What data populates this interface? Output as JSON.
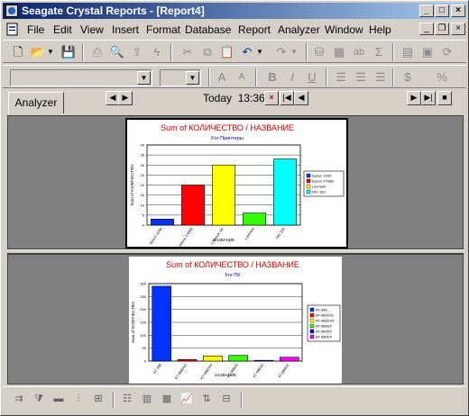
{
  "window": {
    "title": "Seagate Crystal Reports - [Report4]",
    "controls": {
      "minimize": "_",
      "maximize": "□",
      "close": "×"
    }
  },
  "menu": {
    "items": [
      "File",
      "Edit",
      "View",
      "Insert",
      "Format",
      "Database",
      "Report",
      "Analyzer",
      "Window",
      "Help"
    ],
    "mdi_controls": {
      "minimize": "_",
      "restore": "❐",
      "close": "×"
    }
  },
  "toolbar1": {
    "icons": [
      "new-icon",
      "open-icon",
      "save-icon",
      "print-icon",
      "print-preview-icon",
      "export-icon",
      "lightning-icon",
      "cut-icon",
      "copy-icon",
      "paste-icon",
      "undo-icon",
      "redo-icon",
      "database-icon",
      "table-icon",
      "text-object-icon",
      "sum-icon",
      "report-icon",
      "window-icon",
      "refresh-icon",
      "help-icon"
    ]
  },
  "toolbar2": {
    "font_name": "",
    "font_size": "",
    "buttons": {
      "grow": "A",
      "shrink": "A",
      "bold": "B",
      "italic": "I",
      "underline": "U",
      "currency": "$",
      "percent": "%"
    }
  },
  "tabrow": {
    "tab_label": "Analyzer",
    "today_label": "Today",
    "time": "13:36",
    "close": "×"
  },
  "chart_data": [
    {
      "type": "bar",
      "title": "Sum of КОЛИЧЕСТВО / НАЗВАНИЕ",
      "subtitle": "For Принтеры",
      "xlabel": "НАЗВАНИЕ",
      "ylabel": "Sum of КОЛИЧЕСТВО",
      "ylim": [
        0,
        40
      ],
      "yticks": [
        0,
        5,
        10,
        15,
        20,
        25,
        30,
        35,
        40
      ],
      "categories": [
        "Epson 1050",
        "Epson FX880",
        "Lexmark Jet",
        "Lexmark",
        "OKI 183"
      ],
      "values": [
        3,
        20,
        30,
        6,
        33
      ],
      "colors": [
        "#0033ff",
        "#ff0000",
        "#ffff00",
        "#33ff00",
        "#00ffff"
      ],
      "legend": [
        "Epson 1050",
        "Epson FX880",
        "Lexmark",
        "OKI 183"
      ],
      "legend_colors": [
        "#0033ff",
        "#ff0000",
        "#ffff00",
        "#00ffff"
      ],
      "legend_position": "right"
    },
    {
      "type": "bar",
      "title": "Sum of КОЛИЧЕСТВО / НАЗВАНИЕ",
      "subtitle": "For ПК",
      "xlabel": "НАЗВАНИЕ",
      "ylabel": "Sum of КОЛИЧЕСТВО",
      "ylim": [
        0,
        300
      ],
      "yticks": [
        0,
        50,
        100,
        150,
        200,
        250,
        300
      ],
      "categories": [
        "AT-386",
        "AT-486DX2",
        "AT-486DX4",
        "AT-586DX",
        "AT-586SX",
        "AT-686DX"
      ],
      "values": [
        290,
        6,
        20,
        22,
        3,
        15
      ],
      "colors": [
        "#0033ff",
        "#ff0000",
        "#ffff00",
        "#33ff00",
        "#0000ff",
        "#ff00ff"
      ],
      "legend": [
        "AT-386",
        "AT-486DX2",
        "AT-486DX4",
        "AT-586DX",
        "AT-586SX",
        "AT-686DX"
      ],
      "legend_position": "right"
    }
  ]
}
